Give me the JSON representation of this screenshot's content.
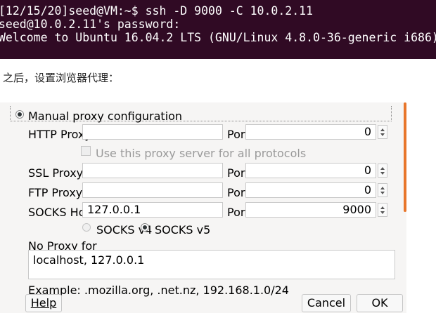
{
  "terminal": {
    "prompt": "[12/15/20]seed@VM:~$ ssh -D 9000 -C 10.0.2.11",
    "password_prompt": "seed@10.0.2.11's password:",
    "welcome": "Welcome to Ubuntu 16.04.2 LTS (GNU/Linux 4.8.0-36-generic i686)"
  },
  "caption": "之后，设置浏览器代理：",
  "proxy_dialog": {
    "manual_proxy_label": "Manual proxy configuration",
    "manual_selected": true,
    "http": {
      "label": "HTTP Proxy",
      "host": "",
      "port_label": "Port",
      "port": "0"
    },
    "use_for_all": {
      "label": "Use this proxy server for all protocols",
      "checked": false
    },
    "ssl": {
      "label": "SSL Proxy",
      "host": "",
      "port_label": "Port",
      "port": "0"
    },
    "ftp": {
      "label": "FTP Proxy",
      "host": "",
      "port_label": "Port",
      "port": "0"
    },
    "socks": {
      "label": "SOCKS Host",
      "host": "127.0.0.1",
      "port_label": "Port",
      "port": "9000"
    },
    "socks_v4": {
      "label": "SOCKS v4",
      "selected": false
    },
    "socks_v5": {
      "label": "SOCKS v5",
      "selected": true
    },
    "no_proxy": {
      "label": "No Proxy for",
      "value": "localhost, 127.0.0.1"
    },
    "example": "Example: .mozilla.org, .net.nz, 192.168.1.0/24",
    "buttons": {
      "help": "Help",
      "cancel": "Cancel",
      "ok": "OK"
    }
  }
}
